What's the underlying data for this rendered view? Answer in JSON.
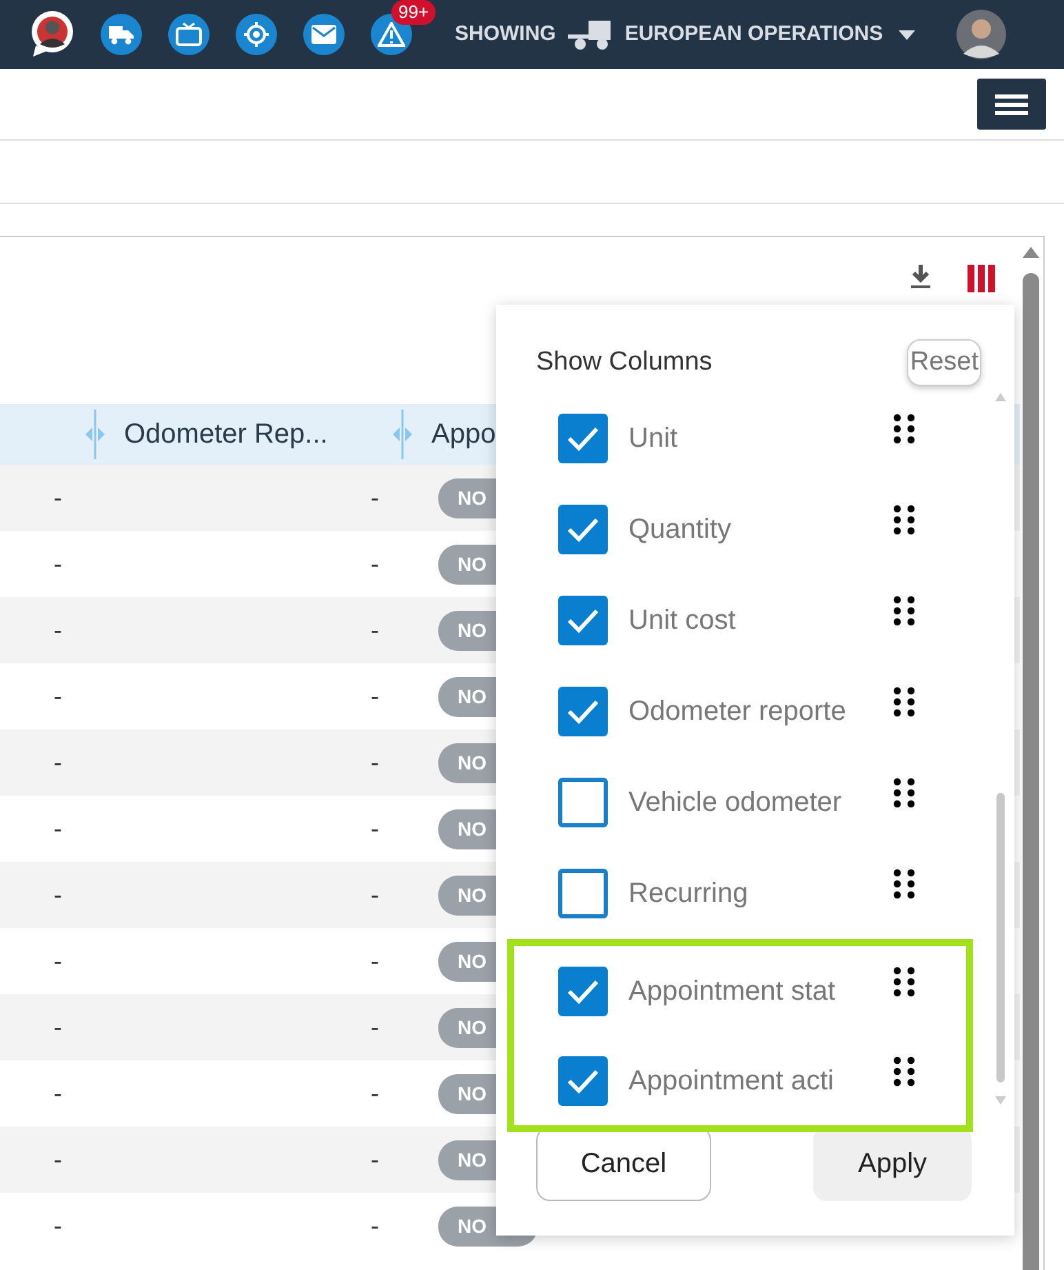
{
  "topbar": {
    "alert_count": "99+",
    "showing_label": "SHOWING",
    "fleet": "EUROPEAN OPERATIONS"
  },
  "table": {
    "columns": [
      {},
      {
        "label": "Odometer Rep..."
      },
      {
        "label": "Appo"
      }
    ],
    "rows": [
      {
        "cells": [
          "-",
          "-"
        ],
        "status": "NO"
      },
      {
        "cells": [
          "-",
          "-"
        ],
        "status": "NO"
      },
      {
        "cells": [
          "-",
          "-"
        ],
        "status": "NO"
      },
      {
        "cells": [
          "-",
          "-"
        ],
        "status": "NO"
      },
      {
        "cells": [
          "-",
          "-"
        ],
        "status": "NO"
      },
      {
        "cells": [
          "-",
          "-"
        ],
        "status": "NO"
      },
      {
        "cells": [
          "-",
          "-"
        ],
        "status": "NO"
      },
      {
        "cells": [
          "-",
          "-"
        ],
        "status": "NO"
      },
      {
        "cells": [
          "-",
          "-"
        ],
        "status": "NO"
      },
      {
        "cells": [
          "-",
          "-"
        ],
        "status": "NO"
      },
      {
        "cells": [
          "-",
          "-"
        ],
        "status": "NO"
      },
      {
        "cells": [
          "-",
          "-"
        ],
        "status": "NO"
      }
    ]
  },
  "column_picker": {
    "title": "Show Columns",
    "reset": "Reset",
    "items": [
      {
        "label": "Unit",
        "checked": true,
        "highlighted": false
      },
      {
        "label": "Quantity",
        "checked": true,
        "highlighted": false
      },
      {
        "label": "Unit cost",
        "checked": true,
        "highlighted": false
      },
      {
        "label": "Odometer reporte",
        "checked": true,
        "highlighted": false
      },
      {
        "label": "Vehicle odometer",
        "checked": false,
        "highlighted": false
      },
      {
        "label": "Recurring",
        "checked": false,
        "highlighted": false
      },
      {
        "label": "Appointment stat",
        "checked": true,
        "highlighted": true
      },
      {
        "label": "Appointment acti",
        "checked": true,
        "highlighted": true
      }
    ],
    "cancel": "Cancel",
    "apply": "Apply"
  }
}
